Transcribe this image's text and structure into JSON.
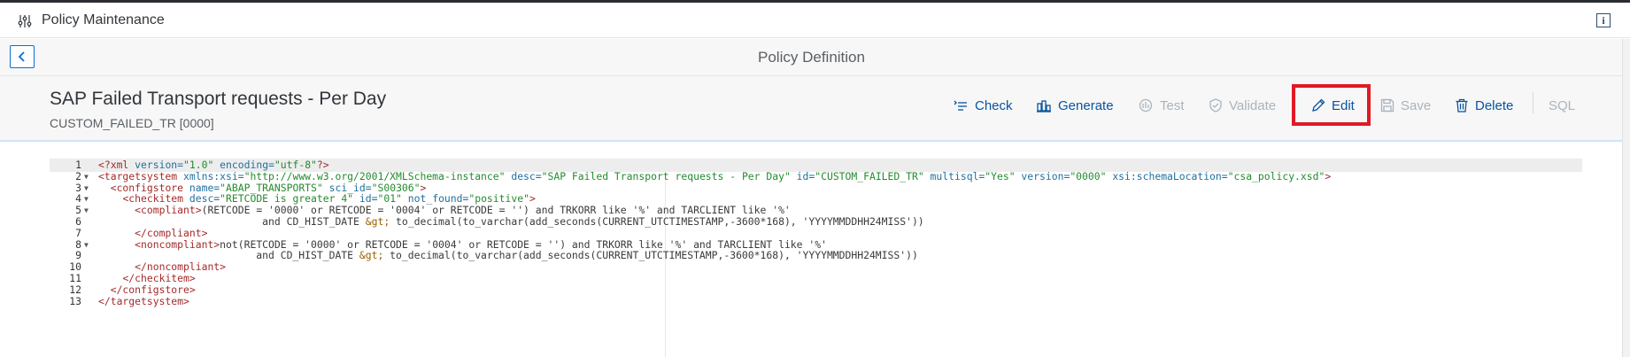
{
  "shell": {
    "app_title": "Policy Maintenance",
    "app_icon": "settings-sliders-icon",
    "info_icon": "info-icon",
    "info_glyph": "i"
  },
  "page": {
    "title": "Policy Definition",
    "back_icon": "chevron-left-icon"
  },
  "object": {
    "title": "SAP Failed Transport requests - Per Day",
    "subtitle": "CUSTOM_FAILED_TR [0000]"
  },
  "toolbar": {
    "check": "Check",
    "generate": "Generate",
    "test": "Test",
    "validate": "Validate",
    "edit": "Edit",
    "save": "Save",
    "delete": "Delete",
    "sql": "SQL"
  },
  "colors": {
    "accent": "#0854a0",
    "highlight": "#e01b24",
    "disabled": "#a9b4be",
    "tag": "#a52a2a",
    "attr": "#1f6f9e",
    "value": "#238a2e"
  },
  "editor": {
    "lines": [
      {
        "n": "1",
        "fold": "",
        "code": [
          [
            "t",
            "<?xml "
          ],
          [
            "a",
            "version="
          ],
          [
            "v",
            "\"1.0\""
          ],
          [
            "a",
            " encoding="
          ],
          [
            "v",
            "\"utf-8\""
          ],
          [
            "t",
            "?>"
          ]
        ]
      },
      {
        "n": "2",
        "fold": "▼",
        "code": [
          [
            "t",
            "<targetsystem "
          ],
          [
            "a",
            "xmlns:xsi="
          ],
          [
            "v",
            "\"http://www.w3.org/2001/XMLSchema-instance\""
          ],
          [
            "a",
            " desc="
          ],
          [
            "v",
            "\"SAP Failed Transport requests - Per Day\""
          ],
          [
            "a",
            " id="
          ],
          [
            "v",
            "\"CUSTOM_FAILED_TR\""
          ],
          [
            "a",
            " multisql="
          ],
          [
            "v",
            "\"Yes\""
          ],
          [
            "a",
            " version="
          ],
          [
            "v",
            "\"0000\""
          ],
          [
            "a",
            " xsi:schemaLocation="
          ],
          [
            "v",
            "\"csa_policy.xsd\""
          ],
          [
            "t",
            ">"
          ]
        ]
      },
      {
        "n": "3",
        "fold": "▼",
        "code": [
          [
            "x",
            "  "
          ],
          [
            "t",
            "<configstore "
          ],
          [
            "a",
            "name="
          ],
          [
            "v",
            "\"ABAP_TRANSPORTS\""
          ],
          [
            "a",
            " sci_id="
          ],
          [
            "v",
            "\"S00306\""
          ],
          [
            "t",
            ">"
          ]
        ]
      },
      {
        "n": "4",
        "fold": "▼",
        "code": [
          [
            "x",
            "    "
          ],
          [
            "t",
            "<checkitem "
          ],
          [
            "a",
            "desc="
          ],
          [
            "v",
            "\"RETCODE is greater 4\""
          ],
          [
            "a",
            " id="
          ],
          [
            "v",
            "\"01\""
          ],
          [
            "a",
            " not_found="
          ],
          [
            "v",
            "\"positive\""
          ],
          [
            "t",
            ">"
          ]
        ]
      },
      {
        "n": "5",
        "fold": "▼",
        "code": [
          [
            "x",
            "      "
          ],
          [
            "t",
            "<compliant>"
          ],
          [
            "x",
            "(RETCODE = '0000' or RETCODE = '0004' or RETCODE = '') and TRKORR like '%' and TARCLIENT like '%'"
          ]
        ]
      },
      {
        "n": "6",
        "fold": "",
        "code": [
          [
            "x",
            "                           and CD_HIST_DATE "
          ],
          [
            "e",
            "&gt;"
          ],
          [
            "x",
            " to_decimal(to_varchar(add_seconds(CURRENT_UTCTIMESTAMP,-3600*168), 'YYYYMMDDHH24MISS'))"
          ]
        ]
      },
      {
        "n": "7",
        "fold": "",
        "code": [
          [
            "x",
            "      "
          ],
          [
            "t",
            "</compliant>"
          ]
        ]
      },
      {
        "n": "8",
        "fold": "▼",
        "code": [
          [
            "x",
            "      "
          ],
          [
            "t",
            "<noncompliant>"
          ],
          [
            "x",
            "not(RETCODE = '0000' or RETCODE = '0004' or RETCODE = '') and TRKORR like '%' and TARCLIENT like '%'"
          ]
        ]
      },
      {
        "n": "9",
        "fold": "",
        "code": [
          [
            "x",
            "                          and CD_HIST_DATE "
          ],
          [
            "e",
            "&gt;"
          ],
          [
            "x",
            " to_decimal(to_varchar(add_seconds(CURRENT_UTCTIMESTAMP,-3600*168), 'YYYYMMDDHH24MISS'))"
          ]
        ]
      },
      {
        "n": "10",
        "fold": "",
        "code": [
          [
            "x",
            "      "
          ],
          [
            "t",
            "</noncompliant>"
          ]
        ]
      },
      {
        "n": "11",
        "fold": "",
        "code": [
          [
            "x",
            "    "
          ],
          [
            "t",
            "</checkitem>"
          ]
        ]
      },
      {
        "n": "12",
        "fold": "",
        "code": [
          [
            "x",
            "  "
          ],
          [
            "t",
            "</configstore>"
          ]
        ]
      },
      {
        "n": "13",
        "fold": "",
        "code": [
          [
            "t",
            "</targetsystem>"
          ]
        ]
      }
    ]
  }
}
